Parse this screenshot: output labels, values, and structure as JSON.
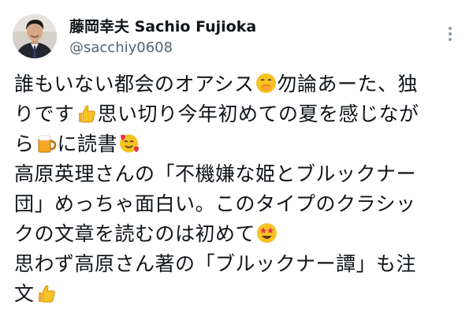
{
  "author": {
    "name": "藤岡幸夫 Sachio Fujioka",
    "handle": "@sacchiy0608"
  },
  "tweet": {
    "line1_a": "誰もいない都会のオアシス",
    "line1_emoji": "grinning-hand-over-mouth-icon",
    "line1_b": "勿論あーた、独",
    "line2_a": "りです",
    "line2_emoji": "thumbs-up-icon",
    "line2_b": "思い切り今年初めての夏を感じなが",
    "line3_a": "ら",
    "line3_emoji1": "beer-mug-icon",
    "line3_b": "に読書",
    "line3_emoji2": "smiling-face-with-hearts-icon",
    "line4": "高原英理さんの「不機嫌な姫とブルックナー",
    "line5": "団」めっちゃ面白い。このタイプのクラシッ",
    "line6_a": "クの文章を読むのは初めて",
    "line6_emoji": "star-struck-icon",
    "line7": "思わず高原さん著の「ブルックナー譚」も注",
    "line8_a": "文",
    "line8_emoji": "thumbs-up-icon"
  },
  "colors": {
    "text": "#0f1419",
    "secondary": "#536471",
    "emoji_yellow": "#f7c324",
    "emoji_orange": "#f5a623",
    "heart_red": "#e8334a"
  }
}
